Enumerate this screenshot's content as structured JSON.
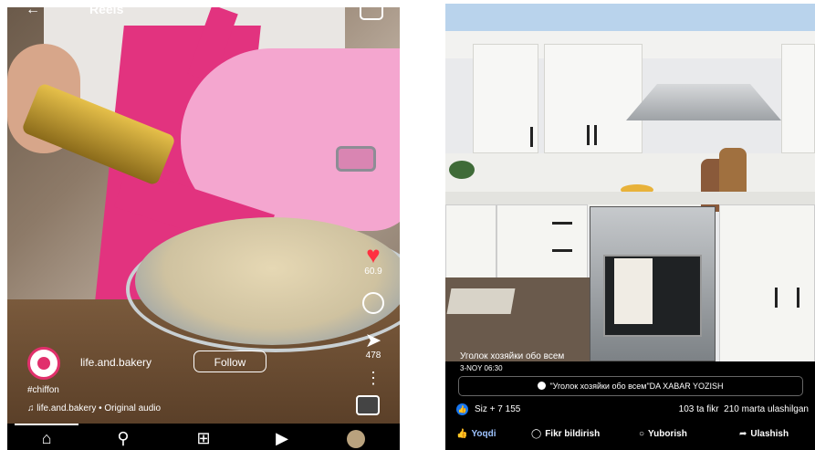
{
  "reel": {
    "title": "Reels",
    "likes": "60.9",
    "shares": "478",
    "username": "life.and.bakery",
    "follow_label": "Follow",
    "caption": "#chiffon",
    "audio": "life.and.bakery • Original audio",
    "icons": {
      "back": "back-arrow-icon",
      "camera": "camera-icon",
      "like": "heart-icon",
      "comment": "comment-icon",
      "share": "send-icon",
      "more": "more-dots-icon",
      "audio": "audio-thumbnail-icon"
    },
    "nav": [
      "home-icon",
      "search-icon",
      "create-icon",
      "reels-icon",
      "profile-avatar"
    ],
    "colors": {
      "accent_like": "#ff3040",
      "brand": "#e1306c"
    }
  },
  "fb": {
    "group_name": "Уголок хозяйки обо всем",
    "date": "3-NOY 06:30",
    "banner": "\"Уголок хозяйки обо всем\"DA XABAR YOZISH",
    "reactions": "Siz + 7 155",
    "comments_count": "103 ta fikr",
    "shares_count": "210 marta ulashilgan",
    "actions": {
      "like": "Yoqdi",
      "comment": "Fikr bildirish",
      "send": "Yuborish",
      "share": "Ulashish"
    },
    "colors": {
      "like_blue": "#1877f2"
    }
  }
}
